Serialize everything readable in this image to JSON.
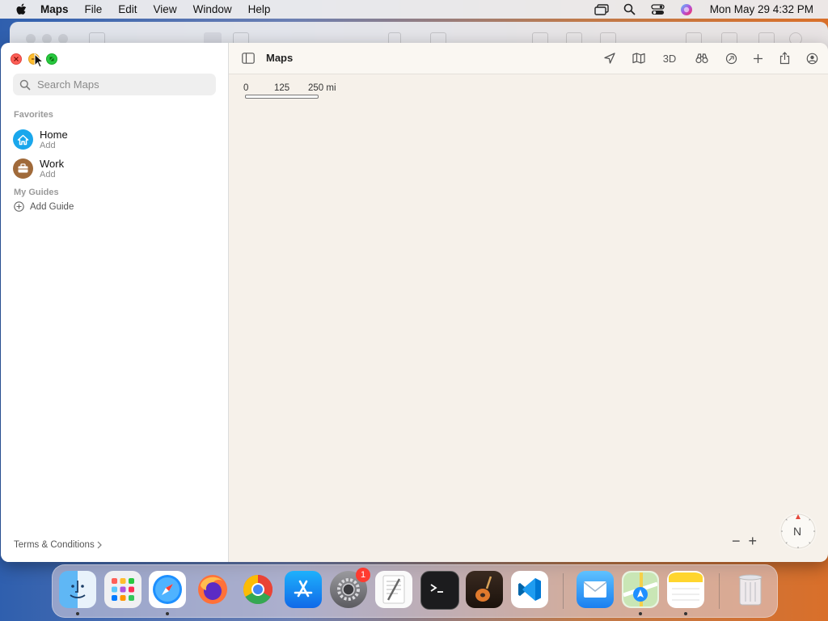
{
  "menubar": {
    "app_name": "Maps",
    "items": [
      "File",
      "Edit",
      "View",
      "Window",
      "Help"
    ],
    "clock": "Mon May 29  4:32 PM"
  },
  "sidebar": {
    "search_placeholder": "Search Maps",
    "favorites_title": "Favorites",
    "favorites": [
      {
        "label": "Home",
        "sub": "Add",
        "icon": "house-icon",
        "color": "#1aa7ec"
      },
      {
        "label": "Work",
        "sub": "Add",
        "icon": "briefcase-icon",
        "color": "#a06a3a"
      }
    ],
    "guides_title": "My Guides",
    "add_guide": "Add Guide",
    "terms": "Terms & Conditions"
  },
  "toolbar": {
    "title": "Maps",
    "three_d": "3D",
    "icons": [
      "location-arrow-icon",
      "map-mode-icon",
      "3d-button",
      "binoculars-icon",
      "tracking-icon",
      "add-icon",
      "share-icon",
      "account-icon"
    ]
  },
  "map": {
    "scale": {
      "zero": "0",
      "mid": "125",
      "end": "250 mi"
    },
    "zoom_out": "−",
    "zoom_in": "+",
    "compass": "N"
  },
  "dock": {
    "apps": [
      "Finder",
      "Launchpad",
      "Safari",
      "Firefox",
      "Chrome",
      "App Store",
      "System Preferences",
      "TextEdit",
      "Terminal",
      "GarageBand",
      "Visual Studio Code",
      "Mail",
      "Maps",
      "Notes",
      "Trash"
    ],
    "system_preferences_badge": "1"
  }
}
